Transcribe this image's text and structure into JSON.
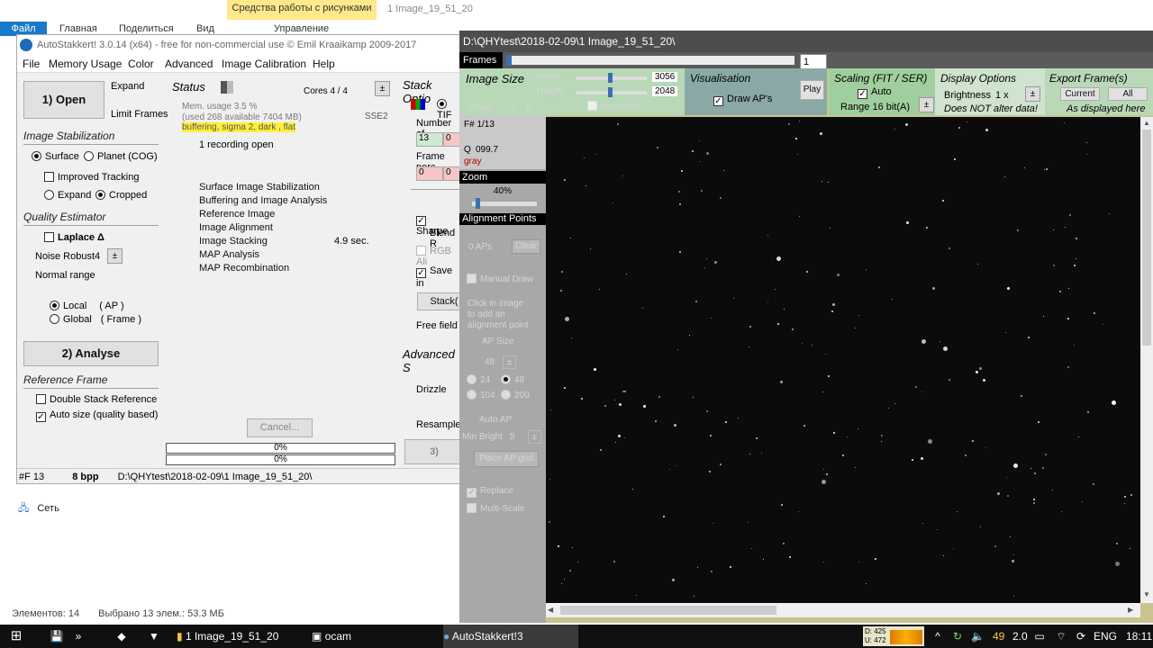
{
  "explorer": {
    "ribbon_tabs": [
      "Файл",
      "Главная",
      "Поделиться",
      "Вид",
      "Управление"
    ],
    "tools_tab": "Средства работы с рисунками",
    "doc_title": "1 Image_19_51_20",
    "network_label": "Сеть",
    "status_elements": "Элементов: 14",
    "status_selected": "Выбрано 13 элем.: 53.3 МБ"
  },
  "as": {
    "title": "AutoStakkert! 3.0.14 (x64) - free for non-commercial use © Emil Kraaikamp 2009-2017",
    "menu": [
      "File",
      "Memory Usage",
      "Color",
      "Advanced",
      "Image Calibration",
      "Help"
    ],
    "open_button": "1) Open",
    "expand_label": "Expand",
    "limit_frames_label": "Limit Frames",
    "image_stabilization_title": "Image Stabilization",
    "surface_label": "Surface",
    "planet_label": "Planet (COG)",
    "improved_tracking_label": "Improved Tracking",
    "expand_radio_label": "Expand",
    "cropped_label": "Cropped",
    "quality_estimator_title": "Quality Estimator",
    "laplace_label": "Laplace Δ",
    "noise_robust_label": "Noise Robust",
    "noise_robust_value": "4",
    "normal_range_label": "Normal range",
    "local_label": "Local",
    "local_sub": "( AP )",
    "global_label": "Global",
    "global_sub": "( Frame )",
    "analyse_button": "2) Analyse",
    "reference_frame_title": "Reference Frame",
    "double_stack_label": "Double Stack Reference",
    "auto_size_label": "Auto size (quality based)",
    "status_title": "Status",
    "cores_label": "Cores 4 / 4",
    "sse_label": "SSE2",
    "mem_usage": "Mem. usage 3.5 %",
    "mem_detail": "(used 268 available 7404 MB)",
    "buffering_info": "buffering, sigma 2, dark , flat",
    "recording_open": "1 recording open",
    "steps": [
      "Surface Image Stabilization",
      "Buffering and Image Analysis",
      "Reference Image",
      "Image Alignment",
      "Image Stacking",
      "MAP Analysis",
      "MAP Recombination"
    ],
    "stacking_time": "4.9 sec.",
    "cancel_button": "Cancel...",
    "progress1": "0%",
    "progress2": "0%",
    "stack_options_title": "Stack Optio",
    "tif_label": "TIF",
    "number_of_label": "Number of",
    "number_value_1": "13",
    "number_value_2": "0",
    "frame_perc_label": "Frame perc",
    "frame_perc_1": "0",
    "frame_perc_2": "0",
    "sharpen_label": "Sharpe",
    "blend_label": "Blend R",
    "rgb_label": "RGB Ali",
    "save_in_label": "Save in",
    "stack_button": "Stack(",
    "free_field_label": "Free field",
    "advanced_s_title": "Advanced S",
    "drizzle_label": "Drizzle",
    "resample_label": "Resample",
    "stack3_button": "3)",
    "status_frame": "#F 13",
    "status_bpp": "8 bpp",
    "status_path": "D:\\QHYtest\\2018-02-09\\1 Image_19_51_20\\"
  },
  "frames": {
    "title": "D:\\QHYtest\\2018-02-09\\1 Image_19_51_20\\",
    "frames_label": "Frames",
    "frame_index": "1",
    "frame_progress": 0.0,
    "image_size_title": "Image Size",
    "width_label": "Width",
    "width_value": "3056",
    "height_label": "Height",
    "height_value": "2048",
    "offset_label": "offset",
    "offset_value": "0 , 0",
    "remember_label": "remember",
    "visualisation_title": "Visualisation",
    "draw_aps_label": "Draw AP's",
    "play_button": "Play",
    "scaling_title": "Scaling (FIT / SER)",
    "auto_label": "Auto",
    "range_label": "Range 16 bit(A)",
    "display_options_title": "Display Options",
    "brightness_label": "Brightness",
    "brightness_value": "1 x",
    "not_alter_label": "Does NOT alter data!",
    "export_title": "Export Frame(s)",
    "current_button": "Current",
    "all_button": "All",
    "as_displayed_label": "As displayed here",
    "frame_num": "F# 1/13",
    "quality_label": "Q",
    "quality_value": "099.7",
    "gray_label": "gray",
    "zoom_label": "Zoom",
    "zoom_value": "40%",
    "zoom_level": 0.4,
    "alignment_points_label": "Alignment Points",
    "aps_count": "0 APs",
    "clear_button": "Clear",
    "manual_draw_label": "Manual Draw",
    "click_hint": "Click in image to add an alignment point",
    "ap_size_label": "AP Size",
    "ap_size_value": "48",
    "ap_sizes": [
      "24",
      "48",
      "104",
      "200"
    ],
    "auto_ap_button": "Auto AP",
    "min_bright_label": "Min Bright",
    "min_bright_value": "5",
    "place_grid_button": "Place AP grid",
    "replace_label": "Replace",
    "multiscale_label": "Multi-Scale"
  },
  "taskbar": {
    "items": [
      "1 Image_19_51_20",
      "ocam",
      "AutoStakkert!3"
    ],
    "perf_d": "D: 425",
    "perf_u": "U: 472",
    "num1": "49",
    "num2": "2.0",
    "lang": "ENG",
    "time": "18:11"
  },
  "colors": {
    "accent_blue": "#1979ca",
    "frames_titlebar": "#4d4d4d",
    "panel_green": "#b8d8b8",
    "highlight_yellow": "#ffef3a"
  }
}
